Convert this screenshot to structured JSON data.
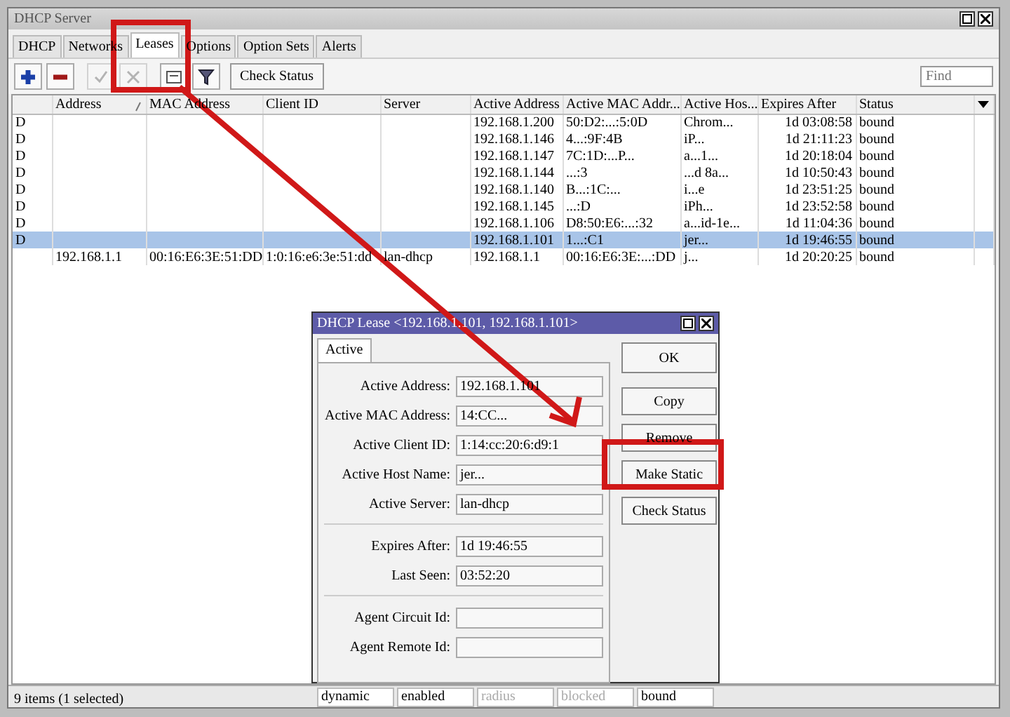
{
  "window": {
    "title": "DHCP Server"
  },
  "tabs": [
    {
      "label": "DHCP",
      "selected": false
    },
    {
      "label": "Networks",
      "selected": false
    },
    {
      "label": "Leases",
      "selected": true
    },
    {
      "label": "Options",
      "selected": false
    },
    {
      "label": "Option Sets",
      "selected": false
    },
    {
      "label": "Alerts",
      "selected": false
    }
  ],
  "toolbar": {
    "tools": [
      {
        "kind": "add",
        "disabled": false
      },
      {
        "kind": "remove",
        "disabled": false
      },
      {
        "kind": "enable",
        "disabled": true
      },
      {
        "kind": "disable",
        "disabled": true
      },
      {
        "kind": "comment",
        "disabled": false
      },
      {
        "kind": "filter",
        "disabled": false
      }
    ],
    "button": "Check Status",
    "find": {
      "placeholder": "Find"
    }
  },
  "table": {
    "columns": [
      {
        "sorted": false
      },
      {
        "label": "Address",
        "sorted": true
      },
      {
        "label": "MAC Address",
        "sorted": false
      },
      {
        "label": "Client ID",
        "sorted": false
      },
      {
        "label": "Server",
        "sorted": false
      },
      {
        "label": "Active Address",
        "sorted": false
      },
      {
        "label": "Active MAC Addr...",
        "sorted": false
      },
      {
        "label": "Active Hos...",
        "sorted": false
      },
      {
        "label": "Expires After",
        "sorted": false
      },
      {
        "label": "Status",
        "sorted": false
      }
    ],
    "rows": [
      {
        "cells": [
          "D",
          "",
          "",
          "",
          "",
          "192.168.1.200",
          "50:D2:...:5:0D",
          "Chrom...",
          "1d 03:08:58",
          "bound"
        ],
        "selected": false
      },
      {
        "cells": [
          "D",
          "",
          "",
          "",
          "",
          "192.168.1.146",
          "4...:9F:4B",
          "iP...",
          "1d 21:11:23",
          "bound"
        ],
        "selected": false
      },
      {
        "cells": [
          "D",
          "",
          "",
          "",
          "",
          "192.168.1.147",
          "7C:1D:...P...",
          "a...1...",
          "1d 20:18:04",
          "bound"
        ],
        "selected": false
      },
      {
        "cells": [
          "D",
          "",
          "",
          "",
          "",
          "192.168.1.144",
          "...:3",
          "...d 8a...",
          "1d 10:50:43",
          "bound"
        ],
        "selected": false
      },
      {
        "cells": [
          "D",
          "",
          "",
          "",
          "",
          "192.168.1.140",
          "B...:1C:...",
          "i...e",
          "1d 23:51:25",
          "bound"
        ],
        "selected": false
      },
      {
        "cells": [
          "D",
          "",
          "",
          "",
          "",
          "192.168.1.145",
          "...:D",
          "iPh...",
          "1d 23:52:58",
          "bound"
        ],
        "selected": false
      },
      {
        "cells": [
          "D",
          "",
          "",
          "",
          "",
          "192.168.1.106",
          "D8:50:E6:...:32",
          "a...id-1e...",
          "1d 11:04:36",
          "bound"
        ],
        "selected": false
      },
      {
        "cells": [
          "D",
          "",
          "",
          "",
          "",
          "192.168.1.101",
          "1...:C1",
          "jer...",
          "1d 19:46:55",
          "bound"
        ],
        "selected": true
      },
      {
        "cells": [
          "",
          "192.168.1.1",
          "00:16:E6:3E:51:DD",
          "1:0:16:e6:3e:51:dd",
          "lan-dhcp",
          "192.168.1.1",
          "00:16:E6:3E:...:DD",
          "j...",
          "1d 20:20:25",
          "bound"
        ],
        "selected": false
      }
    ]
  },
  "status_bar": "9 items (1 selected)",
  "dialog": {
    "title": "DHCP Lease <192.168.1.101, 192.168.1.101>",
    "tab": "Active",
    "groups": [
      [
        {
          "label": "Active Address:",
          "value": "192.168.1.101"
        },
        {
          "label": "Active MAC Address:",
          "value": "14:CC..."
        },
        {
          "label": "Active Client ID:",
          "value": "1:14:cc:20:6:d9:1"
        },
        {
          "label": "Active Host Name:",
          "value": "jer..."
        },
        {
          "label": "Active Server:",
          "value": "lan-dhcp"
        }
      ],
      [
        {
          "label": "Expires After:",
          "value": "1d 19:46:55"
        },
        {
          "label": "Last Seen:",
          "value": "03:52:20"
        }
      ],
      [
        {
          "label": "Agent Circuit Id:"
        },
        {
          "label": "Agent Remote Id:"
        }
      ]
    ],
    "buttons": [
      "OK",
      "Copy",
      "Remove",
      "Make Static",
      "Check Status"
    ],
    "flags": [
      {
        "label": "dynamic",
        "disabled": false
      },
      {
        "label": "enabled",
        "disabled": false
      },
      {
        "label": "radius",
        "disabled": true
      },
      {
        "label": "blocked",
        "disabled": true
      },
      {
        "label": "bound",
        "disabled": false
      }
    ]
  }
}
